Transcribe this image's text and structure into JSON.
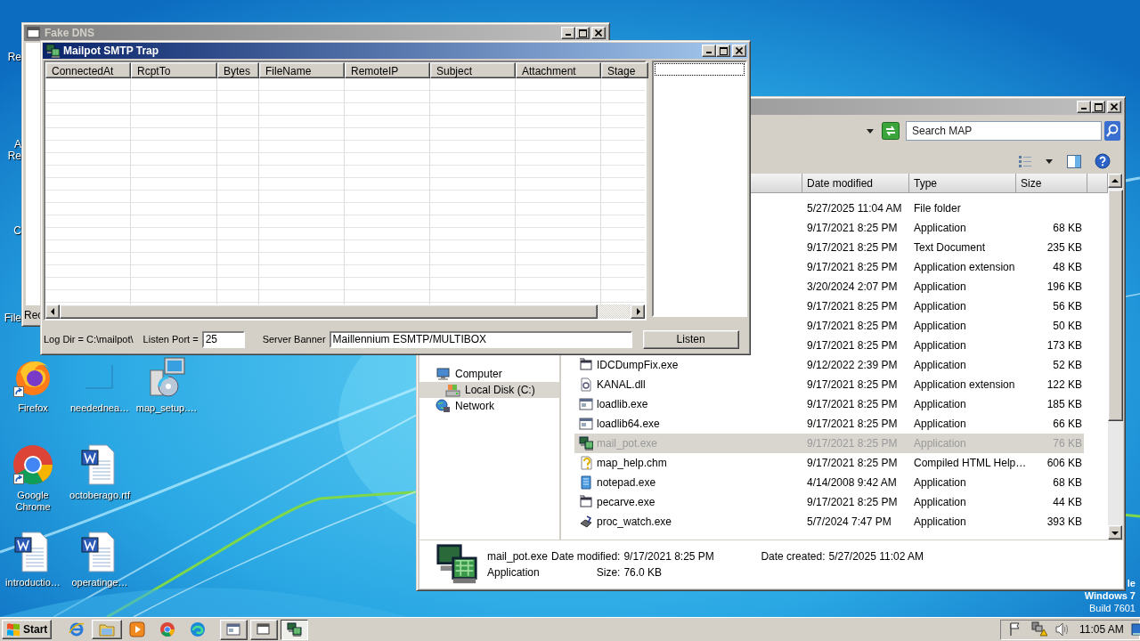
{
  "desktop": {
    "covered_icons": [
      {
        "lines": [
          "Re"
        ]
      },
      {
        "lines": [
          "A",
          "Re"
        ]
      },
      {
        "lines": [
          "C"
        ]
      },
      {
        "lines": [
          "File"
        ]
      }
    ],
    "icon_rows": [
      [
        {
          "label": "Firefox",
          "kind": "firefox"
        },
        {
          "label": "needednea…",
          "kind": "blank"
        },
        {
          "label": "map_setup.…",
          "kind": "installer"
        }
      ],
      [
        {
          "label": "Google Chrome",
          "kind": "chrome"
        },
        {
          "label": "octoberago.rtf",
          "kind": "word"
        }
      ],
      [
        {
          "label": "introductio…",
          "kind": "word"
        },
        {
          "label": "operatinge…",
          "kind": "word"
        }
      ]
    ],
    "os_text": [
      "le",
      "Windows 7",
      "Build 7601"
    ]
  },
  "fake_dns_window": {
    "title": "Fake DNS",
    "active": false,
    "covered_label": "Rec"
  },
  "mailpot_window": {
    "title": "Mailpot SMTP Trap",
    "active": true,
    "columns": [
      "ConnectedAt",
      "RcptTo",
      "Bytes",
      "FileName",
      "RemoteIP",
      "Subject",
      "Attachment",
      "Stage"
    ],
    "log_dir": "Log Dir = C:\\mailpot\\",
    "listen_port_label": "Listen Port =",
    "listen_port": "25",
    "server_banner_label": "Server Banner",
    "server_banner": "Maillennium ESMTP/MULTIBOX",
    "listen_button": "Listen"
  },
  "explorer_window": {
    "active": false,
    "search_placeholder": "Search MAP",
    "columns": [
      "Date modified",
      "Type",
      "Size"
    ],
    "nav": [
      {
        "label": "Computer",
        "kind": "computer",
        "selected": false,
        "children": [
          {
            "label": "Local Disk (C:)",
            "kind": "disk",
            "selected": true
          }
        ]
      },
      {
        "label": "Network",
        "kind": "network",
        "selected": false
      }
    ],
    "files": [
      {
        "date": "5/27/2025 11:04 AM",
        "type": "File folder",
        "selected": false
      },
      {
        "date": "9/17/2021 8:25 PM",
        "type": "Application",
        "size": "68 KB",
        "selected": false
      },
      {
        "date": "9/17/2021 8:25 PM",
        "type": "Text Document",
        "size": "235 KB",
        "selected": false
      },
      {
        "date": "9/17/2021 8:25 PM",
        "type": "Application extension",
        "size": "48 KB",
        "selected": false
      },
      {
        "date": "3/20/2024 2:07 PM",
        "type": "Application",
        "size": "196 KB",
        "selected": false
      },
      {
        "date": "9/17/2021 8:25 PM",
        "type": "Application",
        "size": "56 KB",
        "selected": false
      },
      {
        "date": "9/17/2021 8:25 PM",
        "type": "Application",
        "size": "50 KB",
        "selected": false
      },
      {
        "date": "9/17/2021 8:25 PM",
        "type": "Application",
        "size": "173 KB",
        "selected": false
      },
      {
        "name": "IDCDumpFix.exe",
        "kind": "exe",
        "date": "9/12/2022 2:39 PM",
        "type": "Application",
        "size": "52 KB",
        "selected": false
      },
      {
        "name": "KANAL.dll",
        "kind": "dll",
        "date": "9/17/2021 8:25 PM",
        "type": "Application extension",
        "size": "122 KB",
        "selected": false
      },
      {
        "name": "loadlib.exe",
        "kind": "app",
        "date": "9/17/2021 8:25 PM",
        "type": "Application",
        "size": "185 KB",
        "selected": false
      },
      {
        "name": "loadlib64.exe",
        "kind": "app",
        "date": "9/17/2021 8:25 PM",
        "type": "Application",
        "size": "66 KB",
        "selected": false
      },
      {
        "name": "mail_pot.exe",
        "kind": "mailpot",
        "date": "9/17/2021 8:25 PM",
        "type": "Application",
        "size": "76 KB",
        "selected": true
      },
      {
        "name": "map_help.chm",
        "kind": "help",
        "date": "9/17/2021 8:25 PM",
        "type": "Compiled HTML Help…",
        "size": "606 KB",
        "selected": false
      },
      {
        "name": "notepad.exe",
        "kind": "notepad",
        "date": "4/14/2008 9:42 AM",
        "type": "Application",
        "size": "68 KB",
        "selected": false
      },
      {
        "name": "pecarve.exe",
        "kind": "exe",
        "date": "9/17/2021 8:25 PM",
        "type": "Application",
        "size": "44 KB",
        "selected": false
      },
      {
        "name": "proc_watch.exe",
        "kind": "watch",
        "date": "5/7/2024 7:47 PM",
        "type": "Application",
        "size": "393 KB",
        "selected": false
      }
    ],
    "details": {
      "name": "mail_pot.exe",
      "type": "Application",
      "properties": [
        {
          "label": "Date modified:",
          "value": "9/17/2021 8:25 PM"
        },
        {
          "label": "Size:",
          "value": "76.0 KB"
        },
        {
          "label": "Date created:",
          "value": "5/27/2025 11:02 AM"
        }
      ]
    }
  },
  "taskbar": {
    "start": "Start",
    "quick_launch": [
      {
        "kind": "ie"
      },
      {
        "kind": "folder"
      },
      {
        "kind": "media"
      },
      {
        "kind": "chrome"
      },
      {
        "kind": "edge"
      }
    ],
    "tasks": [
      {
        "kind": "app",
        "selected": false
      },
      {
        "kind": "window",
        "selected": false
      },
      {
        "kind": "mailpot",
        "selected": true
      }
    ],
    "tray": {
      "icons": [
        {
          "kind": "flag"
        },
        {
          "kind": "network"
        },
        {
          "kind": "speaker"
        }
      ],
      "clock": "11:05 AM"
    }
  }
}
